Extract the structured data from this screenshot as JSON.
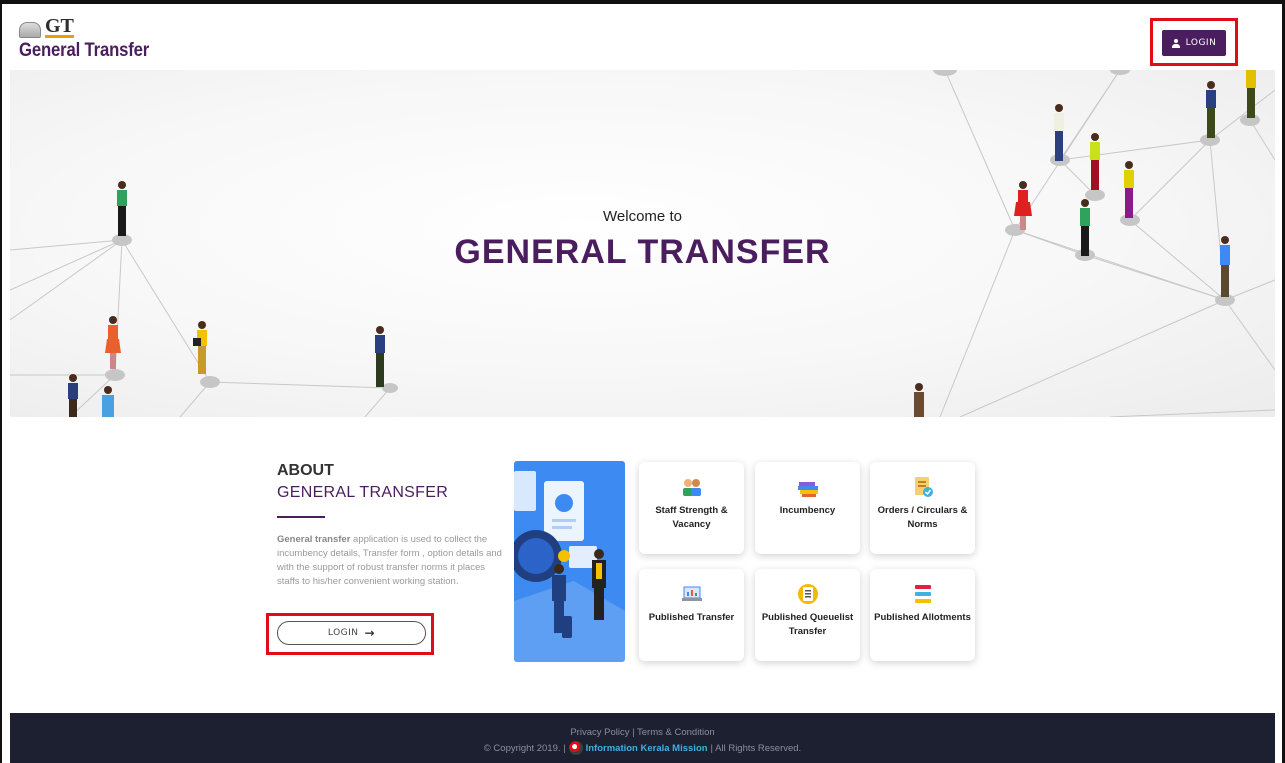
{
  "header": {
    "logo_mark": "GT",
    "logo_text": "General Transfer",
    "login_label": "LOGIN"
  },
  "hero": {
    "welcome": "Welcome to",
    "title": "GENERAL TRANSFER"
  },
  "about": {
    "heading": "ABOUT",
    "subheading": "GENERAL TRANSFER",
    "desc_bold": "General transfer",
    "desc_rest": " application is used to collect the incumbency details, Transfer form , option details and with the support of robust transfer norms it places staffs to his/her convenient working station.",
    "login_label": "LOGIN"
  },
  "cards": [
    {
      "label": "Staff Strength & Vacancy",
      "icon": "staff-icon"
    },
    {
      "label": "Incumbency",
      "icon": "books-icon"
    },
    {
      "label": "Orders / Circulars & Norms",
      "icon": "document-check-icon"
    },
    {
      "label": "Published Transfer",
      "icon": "laptop-chart-icon"
    },
    {
      "label": "Published Queuelist Transfer",
      "icon": "clipboard-icon"
    },
    {
      "label": "Published Allotments",
      "icon": "list-icon"
    }
  ],
  "footer": {
    "links": "Privacy Policy | Terms & Condition",
    "copyright": "© Copyright 2019. |",
    "org": "Information Kerala Mission",
    "rights": "| All Rights Reserved."
  },
  "colors": {
    "brand": "#4a1d5e",
    "highlight": "#e00d17",
    "footer_bg": "#1c2030",
    "illustration_bg": "#3d8bf2"
  }
}
